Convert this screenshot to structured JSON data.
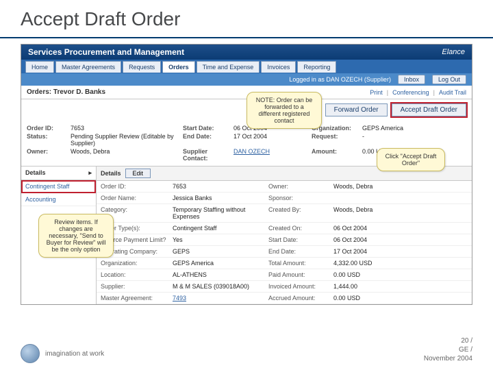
{
  "slide": {
    "title": "Accept Draft Order"
  },
  "appHeader": {
    "brand": "Services Procurement and Management",
    "vendor": "Elance"
  },
  "tabs": [
    "Home",
    "Master Agreements",
    "Requests",
    "Orders",
    "Time and Expense",
    "Invoices",
    "Reporting"
  ],
  "userbar": {
    "logged": "Logged in as DAN OZECH (Supplier)",
    "inbox": "Inbox",
    "logout": "Log Out"
  },
  "crumb": "Orders: Trevor D. Banks",
  "rightLinks": [
    "Print",
    "Conferencing",
    "Audit Trail"
  ],
  "actions": {
    "forward": "Forward Order",
    "accept": "Accept Draft Order"
  },
  "meta": {
    "orderIdLab": "Order ID:",
    "orderId": "7653",
    "statusLab": "Status:",
    "status": "Pending Supplier Review (Editable by Supplier)",
    "ownerLab": "Owner:",
    "owner": "Woods, Debra",
    "startLab": "Start Date:",
    "start": "06 Oct 2004",
    "endLab": "End Date:",
    "end": "17 Oct 2004",
    "suppLab": "Supplier Contact:",
    "supp": "DAN OZECH",
    "orgLab": "Organization:",
    "org": "GEPS America",
    "reqLab": "Request:",
    "req": "-",
    "amtLab": "Amount:",
    "amt": "0.00 USD"
  },
  "side": {
    "header": "Details",
    "items": [
      "Contingent Staff",
      "Accounting"
    ]
  },
  "detailHeader": {
    "label": "Details",
    "edit": "Edit"
  },
  "details": [
    {
      "k1": "Order ID:",
      "v1": "7653",
      "k2": "Owner:",
      "v2": "Woods, Debra"
    },
    {
      "k1": "Order Name:",
      "v1": "Jessica Banks",
      "k2": "Sponsor:",
      "v2": ""
    },
    {
      "k1": "Category:",
      "v1": "Temporary Staffing without Expenses",
      "k2": "Created By:",
      "v2": "Woods, Debra"
    },
    {
      "k1": "Order Type(s):",
      "v1": "Contingent Staff",
      "k2": "Created On:",
      "v2": "06 Oct 2004"
    },
    {
      "k1": "Enforce Payment Limit?",
      "v1": "Yes",
      "k2": "Start Date:",
      "v2": "06 Oct 2004"
    },
    {
      "k1": "Operating Company:",
      "v1": "GEPS",
      "k2": "End Date:",
      "v2": "17 Oct 2004"
    },
    {
      "k1": "Organization:",
      "v1": "GEPS America",
      "k2": "Total Amount:",
      "v2": "4,332.00 USD"
    },
    {
      "k1": "Location:",
      "v1": "AL-ATHENS",
      "k2": "Paid Amount:",
      "v2": "0.00 USD"
    },
    {
      "k1": "Supplier:",
      "v1": "M & M SALES (039018A00)",
      "k2": "Invoiced Amount:",
      "v2": "1,444.00"
    },
    {
      "k1": "Master Agreement:",
      "v1": "7493",
      "k2": "Accrued Amount:",
      "v2": "0.00 USD"
    }
  ],
  "callouts": {
    "co1": "NOTE: Order can be forwarded to a different registered contact",
    "co2": "Click \"Accept Draft Order\"",
    "co3": "Review items. If changes are necessary, \"Send to Buyer for Review\" will be the only option"
  },
  "footer": {
    "tag": "imagination at work",
    "p1": "20 /",
    "p2": "GE /",
    "p3": "November 2004"
  }
}
